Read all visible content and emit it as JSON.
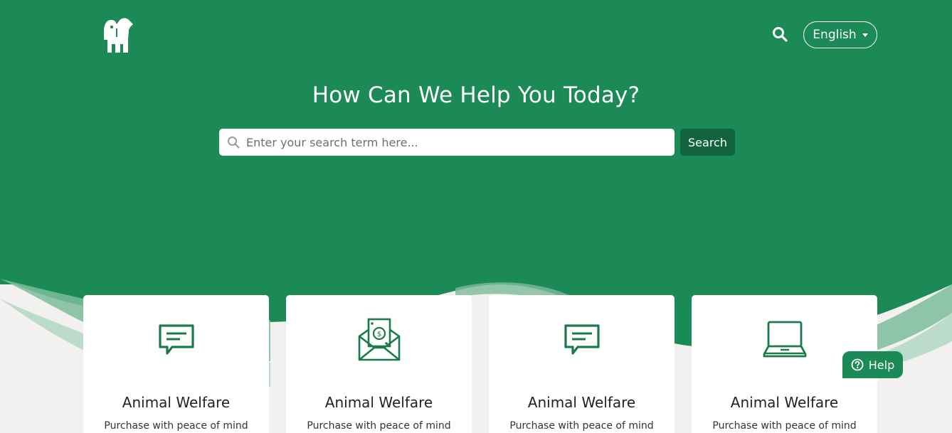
{
  "header": {
    "language_label": "English"
  },
  "hero": {
    "title": "How Can We Help You Today?",
    "search": {
      "placeholder": "Enter your search term here...",
      "button_label": "Search"
    }
  },
  "cards": [
    {
      "icon": "chat-message-icon",
      "title": "Animal Welfare",
      "description": "Purchase with peace of mind"
    },
    {
      "icon": "money-envelope-icon",
      "title": "Animal Welfare",
      "description": "Purchase with peace of mind"
    },
    {
      "icon": "chat-message-icon",
      "title": "Animal Welfare",
      "description": "Purchase with peace of mind"
    },
    {
      "icon": "laptop-icon",
      "title": "Animal Welfare",
      "description": "Purchase with peace of mind"
    }
  ],
  "help_widget": {
    "label": "Help"
  },
  "colors": {
    "brand_green": "#1b8a57",
    "button_dark_green": "#11643e",
    "icon_green": "#1a7a4c",
    "background": "#f2f1ef"
  }
}
